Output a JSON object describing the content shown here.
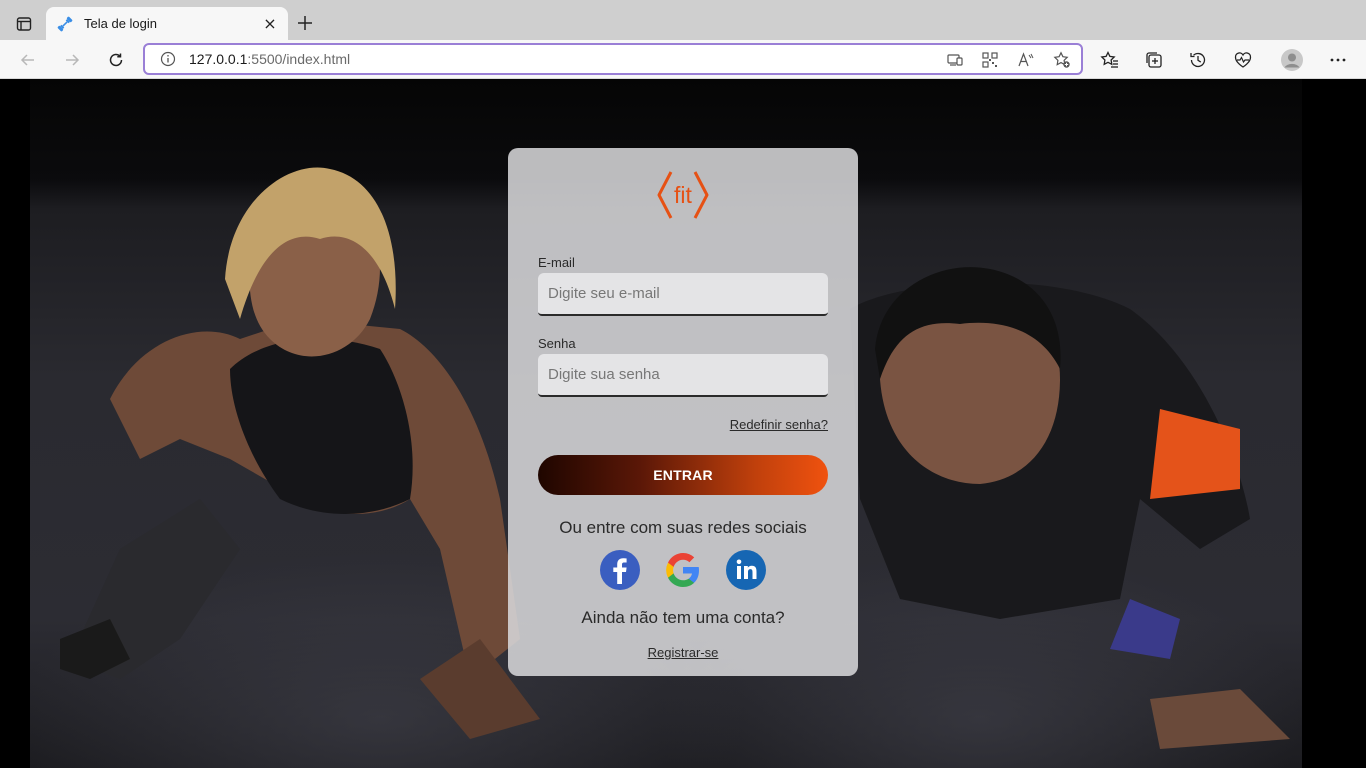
{
  "browser": {
    "tab": {
      "title": "Tela de login",
      "favicon": "dumbbell-icon",
      "close": "×"
    },
    "address": {
      "url_host": "127.0.0.1",
      "url_rest": ":5500/index.html"
    },
    "accent_color": "#9a7fd6"
  },
  "login": {
    "logo_text": "fit",
    "email_label": "E-mail",
    "email_placeholder": "Digite seu e-mail",
    "password_label": "Senha",
    "password_placeholder": "Digite sua senha",
    "forgot_link": "Redefinir senha?",
    "submit_label": "ENTRAR",
    "social_prompt": "Ou entre com suas redes sociais",
    "social": [
      {
        "name": "facebook-icon",
        "color": "#3b5998"
      },
      {
        "name": "google-icon",
        "color": "#4285f4"
      },
      {
        "name": "linkedin-icon",
        "color": "#0a66c2"
      }
    ],
    "no_account_text": "Ainda não tem uma conta?",
    "register_link": "Registrar-se",
    "brand_color": "#f0520f"
  }
}
